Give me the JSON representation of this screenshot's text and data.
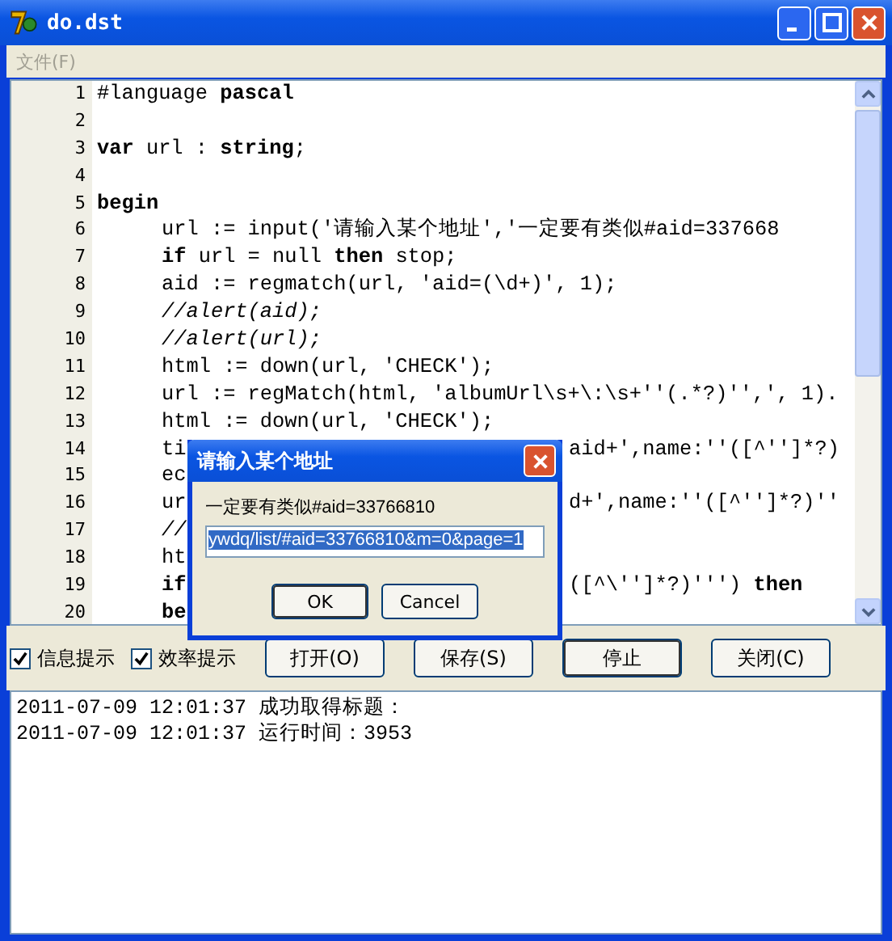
{
  "window": {
    "title": "do.dst"
  },
  "menu": [
    {
      "label": "文件(F)",
      "disabled": true
    }
  ],
  "editor": {
    "lines": [
      {
        "number": "1",
        "text": "#language **pascal**"
      },
      {
        "number": "2"
      },
      {
        "number": "3",
        "text": "**var** url : **string**;"
      },
      {
        "number": "4"
      },
      {
        "number": "5",
        "text": "**begin**",
        "children": [
          {
            "number": "6",
            "text": "url := input('请输入某个地址','一定要有类似#aid=337668"
          },
          {
            "number": "7",
            "text": "**if** url = null **then** stop;"
          },
          {
            "number": "8",
            "text": "aid := regmatch(url, 'aid=(\\d+)', 1);"
          },
          {
            "number": "9",
            "text": "//alert(aid);",
            "kind": "comment"
          },
          {
            "number": "10",
            "text": "//alert(url);",
            "kind": "comment"
          },
          {
            "number": "11",
            "text": "html := down(url, 'CHECK');"
          },
          {
            "number": "12",
            "text": "url := regMatch(html, 'albumUrl\\s+\\:\\s+''(.*?)'',', 1)."
          },
          {
            "number": "13",
            "text": "html := down(url, 'CHECK');"
          },
          {
            "number": "14",
            "text": "ti",
            "tail": "aid+',name:''([^'']*?)"
          },
          {
            "number": "15",
            "text": "ec"
          },
          {
            "number": "16",
            "text": "ur",
            "tail": "d+',name:''([^'']*?)''"
          },
          {
            "number": "17",
            "text": "//",
            "kind": "comment"
          },
          {
            "number": "18",
            "text": "ht"
          },
          {
            "number": "19",
            "text": "**if**",
            "tail": "([^\\'']*?)''') **then**"
          },
          {
            "number": "20",
            "text": "**be**"
          }
        ]
      }
    ]
  },
  "options": [
    {
      "label": "信息提示",
      "checked": true
    },
    {
      "label": "效率提示",
      "checked": true
    }
  ],
  "buttons": [
    {
      "label": "打开(O)",
      "default": false
    },
    {
      "label": "保存(S)",
      "default": false
    },
    {
      "label": "停止",
      "default": true
    },
    {
      "label": "关闭(C)",
      "default": false
    }
  ],
  "log": [
    "2011-07-09 12:01:37 成功取得标题：",
    "2011-07-09 12:01:37 运行时间：3953"
  ],
  "dialog": {
    "title": "请输入某个地址",
    "prompt": "一定要有类似#aid=33766810",
    "value": "ywdq/list/#aid=33766810&m=0&page=1",
    "buttons": [
      "OK",
      "Cancel"
    ]
  }
}
